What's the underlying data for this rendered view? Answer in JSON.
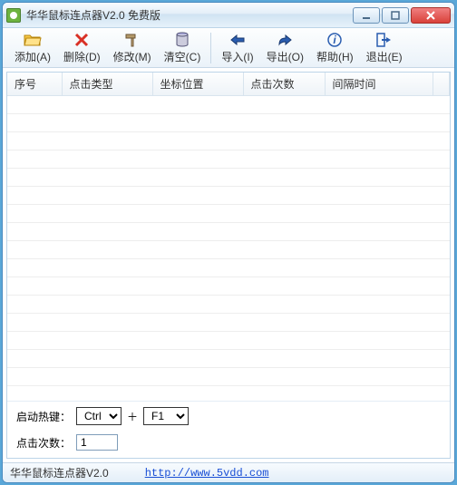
{
  "title": "华华鼠标连点器V2.0 免费版",
  "toolbar": {
    "add": "添加(A)",
    "delete": "删除(D)",
    "modify": "修改(M)",
    "clear": "清空(C)",
    "import": "导入(I)",
    "export": "导出(O)",
    "help": "帮助(H)",
    "exit": "退出(E)"
  },
  "columns": {
    "seq": "序号",
    "type": "点击类型",
    "pos": "坐标位置",
    "count": "点击次数",
    "interval": "间隔时间"
  },
  "hotkey": {
    "label": "启动热键：",
    "mod": "Ctrl",
    "key": "F1",
    "plus": "＋"
  },
  "click": {
    "label": "点击次数：",
    "value": "1"
  },
  "status": {
    "ver": "华华鼠标连点器V2.0",
    "url": "http://www.5vdd.com"
  }
}
